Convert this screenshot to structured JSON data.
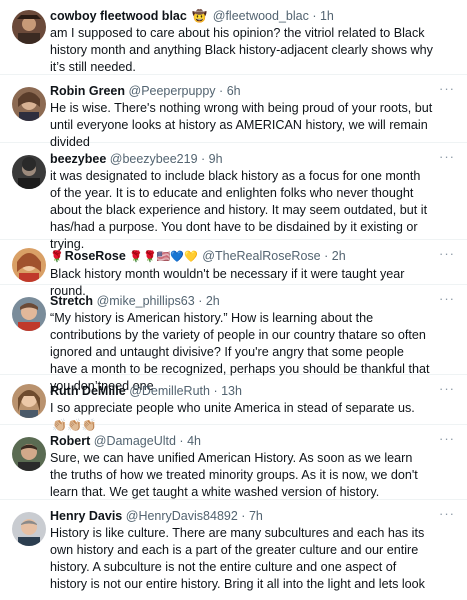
{
  "tweets": [
    {
      "name": "cowboy fleetwood blac",
      "badge": "🤠",
      "handle": "@fleetwood_blac",
      "time": "1h",
      "text": "am I supposed to care about his opinion? the vitriol related to Black history month and anything Black history-adjacent clearly shows why it’s still needed."
    },
    {
      "name": "Robin Green",
      "handle": "@Peeperpuppy",
      "time": "6h",
      "text": "He is wise.  There's nothing wrong with being proud of your roots, but until everyone looks at history as AMERICAN history, we will remain divided"
    },
    {
      "name": "beezybee",
      "handle": "@beezybee219",
      "time": "9h",
      "text": "it was designated to include black history as a focus for one month of the year. It is to educate and enlighten folks who never thought about the black experience and history. It may seem outdated, but it has/had a purpose. You dont have to be disdained by it existing or trying."
    },
    {
      "name": "RoseRose",
      "name_emoji_before": "🌹",
      "name_emoji_after": "🌹🌹🇺🇸💙💛",
      "handle": "@TheRealRoseRose",
      "time": "2h",
      "text": "Black history month wouldn't be necessary if it were taught year round."
    },
    {
      "name": "Stretch",
      "handle": "@mike_phillips63",
      "time": "2h",
      "text": "“My history is American history.” How is learning about the contributions by the variety of people in our country thatare so often ignored and untaught divisive? If you're angry that some people have a month to be recognized, perhaps you should be thankful that you don’tneed one"
    },
    {
      "name": "Ruth DeMille",
      "handle": "@DemilleRuth",
      "time": "13h",
      "text": "I so appreciate people who unite America in stead of separate us.",
      "trailing_emoji": "👏🏼👏🏼👏🏼"
    },
    {
      "name": "Robert",
      "handle": "@DamageUltd",
      "time": "4h",
      "text": "Sure, we can have unified American History. As soon as we learn the truths of how we treated minority groups. As it is now, we don't learn that. We get taught a white washed version of history."
    },
    {
      "name": "Henry Davis",
      "handle": "@HenryDavis84892",
      "time": "7h",
      "text": "History is like culture. There are many subcultures and each has its own history and each is a part of the greater culture and our entire history. A subculture is not the entire culture and one aspect of history is not our entire history. Bring it all into the light and lets look"
    }
  ],
  "ui": {
    "dot": "·",
    "more": "···"
  },
  "icons": [
    "avatar-photo",
    "more-options-icon",
    "cowboy-emoji",
    "rose-emoji",
    "us-flag-emoji",
    "heart-emoji",
    "clap-emoji"
  ],
  "colors": {
    "text": "#0f1419",
    "secondary": "#536471",
    "divider": "#eff3f4"
  }
}
